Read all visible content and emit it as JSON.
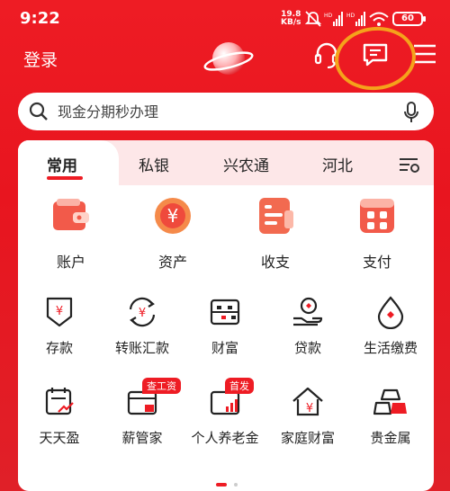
{
  "status_bar": {
    "time": "9:22",
    "speed_value": "19.8",
    "speed_unit": "KB/s",
    "battery": "60"
  },
  "header": {
    "login_label": "登录"
  },
  "search": {
    "placeholder": "现金分期秒办理"
  },
  "tabs": [
    {
      "label": "常用"
    },
    {
      "label": "私银"
    },
    {
      "label": "兴农通"
    },
    {
      "label": "河北"
    }
  ],
  "quick_actions": [
    {
      "label": "账户"
    },
    {
      "label": "资产"
    },
    {
      "label": "收支"
    },
    {
      "label": "支付"
    }
  ],
  "services_row1": [
    {
      "label": "存款"
    },
    {
      "label": "转账汇款"
    },
    {
      "label": "财富"
    },
    {
      "label": "贷款"
    },
    {
      "label": "生活缴费"
    }
  ],
  "services_row2": [
    {
      "label": "天天盈"
    },
    {
      "label": "薪管家",
      "badge": "查工资"
    },
    {
      "label": "个人养老金",
      "badge": "首发"
    },
    {
      "label": "家庭财富"
    },
    {
      "label": "贵金属"
    }
  ],
  "colors": {
    "brand_red": "#ee1c24",
    "annotation_orange": "#f5a21b",
    "tab_bar_pink": "#fde7e8"
  }
}
